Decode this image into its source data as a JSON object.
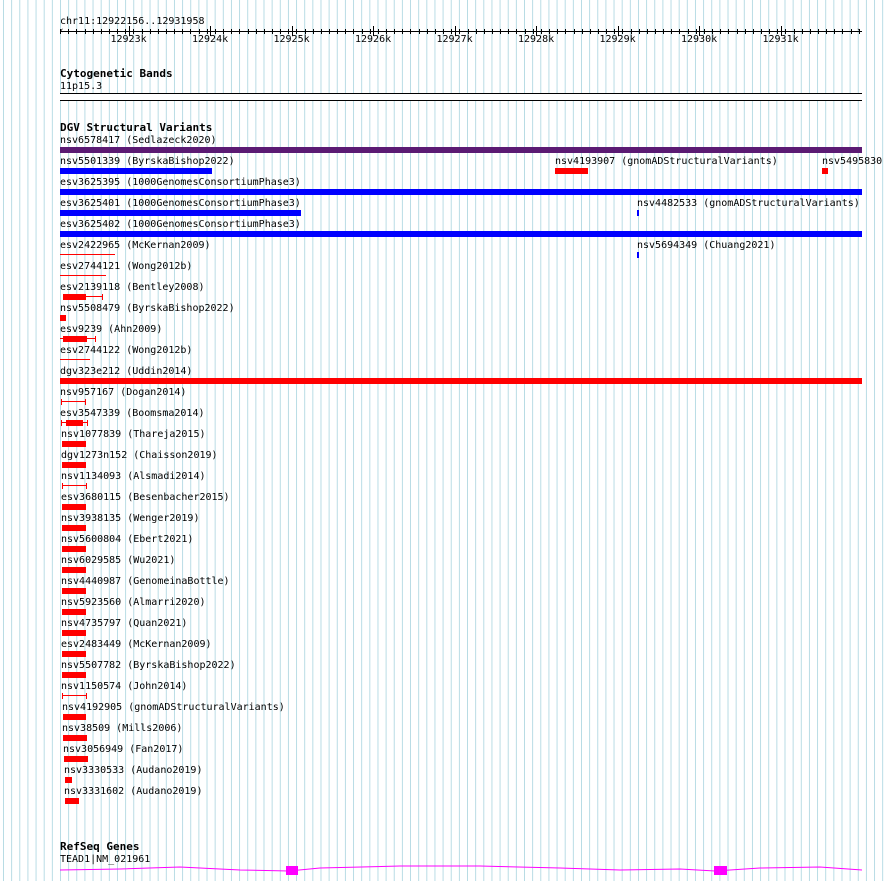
{
  "locus": "chr11:12922156..12931958",
  "ruler": {
    "ticks": [
      "12923k",
      "12924k",
      "12925k",
      "12926k",
      "12927k",
      "12928k",
      "12929k",
      "12930k",
      "12931k"
    ]
  },
  "cytobands": {
    "title": "Cytogenetic Bands",
    "band": "11p15.3"
  },
  "dgv": {
    "title": "DGV Structural Variants",
    "colors": {
      "loss": "#ff0000",
      "gain": "#0000ff",
      "complex": "#5b1a73"
    },
    "features": [
      {
        "label": "nsv6578417 (Sedlazeck2020)",
        "type": "complex"
      },
      {
        "label": "nsv5501339 (ByrskaBishop2022)",
        "type": "gain"
      },
      {
        "label": "nsv4193907 (gnomADStructuralVariants)",
        "type": "loss"
      },
      {
        "label": "nsv5495830",
        "type": "loss"
      },
      {
        "label": "esv3625395 (1000GenomesConsortiumPhase3)",
        "type": "gain"
      },
      {
        "label": "esv3625401 (1000GenomesConsortiumPhase3)",
        "type": "gain"
      },
      {
        "label": "nsv4482533 (gnomADStructuralVariants)",
        "type": "gain"
      },
      {
        "label": "esv3625402 (1000GenomesConsortiumPhase3)",
        "type": "gain"
      },
      {
        "label": "esv2422965 (McKernan2009)",
        "type": "loss"
      },
      {
        "label": "nsv5694349 (Chuang2021)",
        "type": "gain"
      },
      {
        "label": "esv2744121 (Wong2012b)",
        "type": "loss"
      },
      {
        "label": "esv2139118 (Bentley2008)",
        "type": "loss"
      },
      {
        "label": "nsv5508479 (ByrskaBishop2022)",
        "type": "loss"
      },
      {
        "label": "esv9239 (Ahn2009)",
        "type": "loss"
      },
      {
        "label": "esv2744122 (Wong2012b)",
        "type": "loss"
      },
      {
        "label": "dgv323e212 (Uddin2014)",
        "type": "loss"
      },
      {
        "label": "nsv957167 (Dogan2014)",
        "type": "loss"
      },
      {
        "label": "esv3547339 (Boomsma2014)",
        "type": "loss"
      },
      {
        "label": "nsv1077839 (Thareja2015)",
        "type": "loss"
      },
      {
        "label": "dgv1273n152 (Chaisson2019)",
        "type": "loss"
      },
      {
        "label": "nsv1134093 (Alsmadi2014)",
        "type": "loss"
      },
      {
        "label": "esv3680115 (Besenbacher2015)",
        "type": "loss"
      },
      {
        "label": "nsv3938135 (Wenger2019)",
        "type": "loss"
      },
      {
        "label": "nsv5600804 (Ebert2021)",
        "type": "loss"
      },
      {
        "label": "nsv6029585 (Wu2021)",
        "type": "loss"
      },
      {
        "label": "nsv4440987 (GenomeinaBottle)",
        "type": "loss"
      },
      {
        "label": "nsv5923560 (Almarri2020)",
        "type": "loss"
      },
      {
        "label": "nsv4735797 (Quan2021)",
        "type": "loss"
      },
      {
        "label": "esv2483449 (McKernan2009)",
        "type": "loss"
      },
      {
        "label": "nsv5507782 (ByrskaBishop2022)",
        "type": "loss"
      },
      {
        "label": "nsv1150574 (John2014)",
        "type": "loss"
      },
      {
        "label": "nsv4192905 (gnomADStructuralVariants)",
        "type": "loss"
      },
      {
        "label": "nsv38509 (Mills2006)",
        "type": "loss"
      },
      {
        "label": "nsv3056949 (Fan2017)",
        "type": "loss"
      },
      {
        "label": "nsv3330533 (Audano2019)",
        "type": "loss"
      },
      {
        "label": "nsv3331602 (Audano2019)",
        "type": "loss"
      }
    ]
  },
  "refseq": {
    "title": "RefSeq Genes",
    "gene": "TEAD1|NM_021961",
    "color": "#ff00ff"
  }
}
